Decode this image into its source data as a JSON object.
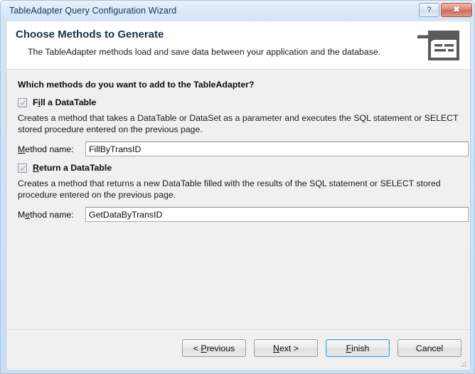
{
  "window": {
    "title": "TableAdapter Query Configuration Wizard",
    "help_button": "?",
    "close_button": "✖",
    "help_icon_name": "help-icon",
    "close_icon_name": "close-icon",
    "accent_color": "#3c9fdc",
    "titlebar_color": "#cfe2f5",
    "body_color": "#f0f0f0"
  },
  "header": {
    "title": "Choose Methods to Generate",
    "subtitle": "The TableAdapter methods load and save data between your application and the database.",
    "icon_name": "generate-methods-icon"
  },
  "main": {
    "prompt": "Which methods do you want to add to the TableAdapter?",
    "sections": [
      {
        "checkbox_label": "Fill a DataTable",
        "checkbox_label_pre": "F",
        "checkbox_label_accel": "i",
        "checkbox_label_post": "ll a DataTable",
        "checked": true,
        "description": "Creates a method that takes a DataTable or DataSet as a parameter and executes the SQL statement or SELECT stored procedure entered on the previous page.",
        "field_label": "Method name:",
        "field_label_pre": "",
        "field_label_accel": "M",
        "field_label_post": "ethod name:",
        "field_value": "FillByTransID"
      },
      {
        "checkbox_label": "Return a DataTable",
        "checkbox_label_pre": "",
        "checkbox_label_accel": "R",
        "checkbox_label_post": "eturn a DataTable",
        "checked": true,
        "description": "Creates a method that returns a new DataTable filled with the results of the SQL statement or SELECT stored procedure entered on the previous page.",
        "field_label": "Method name:",
        "field_label_pre": "M",
        "field_label_accel": "e",
        "field_label_post": "thod name:",
        "field_value": "GetDataByTransID"
      }
    ]
  },
  "footer": {
    "buttons": [
      {
        "name": "previous",
        "pre": "< ",
        "accel": "P",
        "post": "revious",
        "label": "< Previous",
        "default": false
      },
      {
        "name": "next",
        "pre": "",
        "accel": "N",
        "post": "ext >",
        "label": "Next >",
        "default": false
      },
      {
        "name": "finish",
        "pre": "",
        "accel": "F",
        "post": "inish",
        "label": "Finish",
        "default": true
      },
      {
        "name": "cancel",
        "pre": "",
        "accel": "",
        "post": "Cancel",
        "label": "Cancel",
        "default": false
      }
    ]
  }
}
